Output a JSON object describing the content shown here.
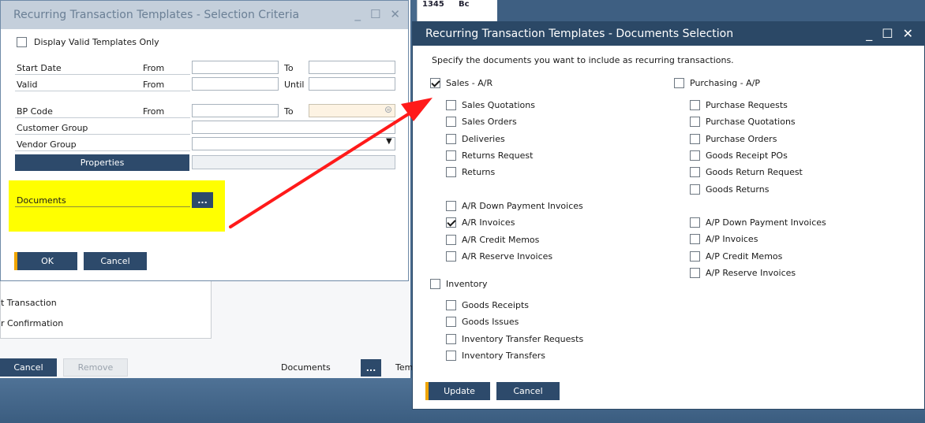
{
  "background": {
    "grid_cells": [
      "1345",
      "Bc"
    ],
    "panel_lines": [
      "t Transaction",
      "r Confirmation"
    ],
    "cancel_label": "Cancel",
    "remove_label": "Remove",
    "documents_label": "Documents",
    "ellipsis": "...",
    "trailing_label": "Tem"
  },
  "criteria_dialog": {
    "title": "Recurring Transaction Templates - Selection Criteria",
    "controls": [
      "_",
      "☐",
      "✕"
    ],
    "display_valid_label": "Display Valid Templates Only",
    "start_date_label": "Start Date",
    "valid_label": "Valid",
    "bp_code_label": "BP Code",
    "customer_group_label": "Customer Group",
    "vendor_group_label": "Vendor Group",
    "from_label": "From",
    "to_label": "To",
    "until_label": "Until",
    "properties_label": "Properties",
    "documents_label": "Documents",
    "ellipsis": "...",
    "ok_label": "OK",
    "cancel_label": "Cancel",
    "start_from_value": "",
    "start_to_value": "",
    "valid_from_value": "",
    "valid_until_value": "",
    "bp_from_value": "",
    "bp_to_value": "",
    "customer_group_value": "",
    "vendor_group_value": "",
    "properties_value": ""
  },
  "documents_dialog": {
    "title": "Recurring Transaction Templates - Documents Selection",
    "controls": [
      "_",
      "☐",
      "✕"
    ],
    "instruction": "Specify the documents you want to include as recurring transactions.",
    "sales_header": "Sales - A/R",
    "sales_checked": true,
    "sales_items": [
      {
        "label": "Sales Quotations",
        "checked": false
      },
      {
        "label": "Sales Orders",
        "checked": false
      },
      {
        "label": "Deliveries",
        "checked": false
      },
      {
        "label": "Returns Request",
        "checked": false
      },
      {
        "label": "Returns",
        "checked": false
      }
    ],
    "sales_items2": [
      {
        "label": "A/R Down Payment Invoices",
        "checked": false
      },
      {
        "label": "A/R Invoices",
        "checked": true
      },
      {
        "label": "A/R Credit Memos",
        "checked": false
      },
      {
        "label": "A/R Reserve Invoices",
        "checked": false
      }
    ],
    "purchasing_header": "Purchasing - A/P",
    "purchasing_checked": false,
    "purchasing_items": [
      {
        "label": "Purchase Requests",
        "checked": false
      },
      {
        "label": "Purchase Quotations",
        "checked": false
      },
      {
        "label": "Purchase Orders",
        "checked": false
      },
      {
        "label": "Goods Receipt POs",
        "checked": false
      },
      {
        "label": "Goods Return Request",
        "checked": false
      },
      {
        "label": "Goods Returns",
        "checked": false
      }
    ],
    "purchasing_items2": [
      {
        "label": "A/P Down Payment Invoices",
        "checked": false
      },
      {
        "label": "A/P Invoices",
        "checked": false
      },
      {
        "label": "A/P Credit Memos",
        "checked": false
      },
      {
        "label": "A/P Reserve Invoices",
        "checked": false
      }
    ],
    "inventory_header": "Inventory",
    "inventory_checked": false,
    "inventory_items": [
      {
        "label": "Goods Receipts",
        "checked": false
      },
      {
        "label": "Goods Issues",
        "checked": false
      },
      {
        "label": "Inventory Transfer Requests",
        "checked": false
      },
      {
        "label": "Inventory Transfers",
        "checked": false
      }
    ],
    "update_label": "Update",
    "cancel_label": "Cancel"
  },
  "colors": {
    "accent": "#f0a500",
    "button": "#2d4a6b",
    "highlight": "#ffff00",
    "arrow": "#ff1a1a"
  }
}
